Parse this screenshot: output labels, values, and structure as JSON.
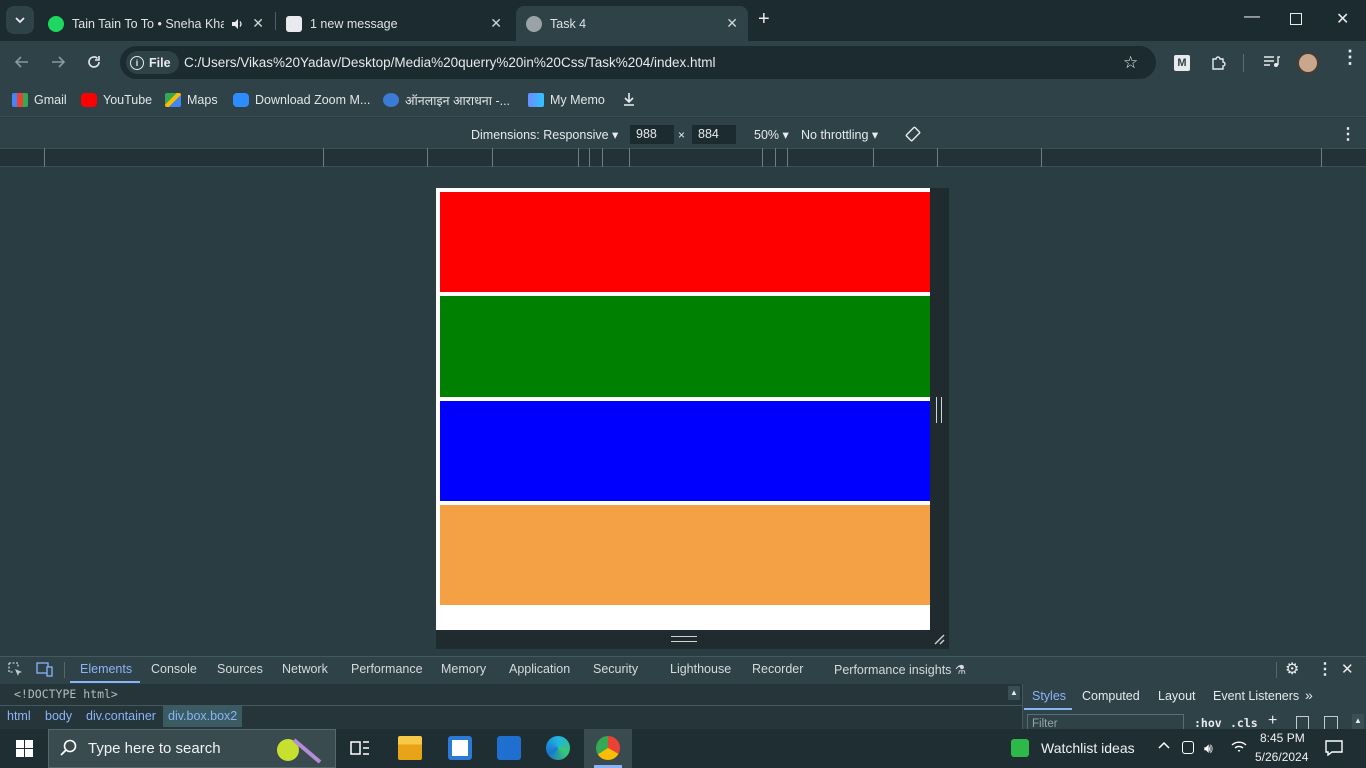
{
  "tabs": [
    {
      "title": "Tain Tain To To • Sneha Khan",
      "favicon": "spotify-icon"
    },
    {
      "title": "1 new message",
      "favicon": "wordpress-icon"
    },
    {
      "title": "Task 4",
      "favicon": "globe-icon",
      "active": true
    }
  ],
  "address_bar": {
    "scheme_label": "File",
    "url": "C:/Users/Vikas%20Yadav/Desktop/Media%20querry%20in%20Css/Task%204/index.html"
  },
  "bookmarks": [
    {
      "label": "Gmail",
      "icon": "gmail-icon"
    },
    {
      "label": "YouTube",
      "icon": "youtube-icon"
    },
    {
      "label": "Maps",
      "icon": "maps-icon"
    },
    {
      "label": "Download Zoom M...",
      "icon": "zoom-icon"
    },
    {
      "label": "ऑनलाइन आराधना -...",
      "icon": "globe-icon"
    },
    {
      "label": "My Memo",
      "icon": "memo-icon"
    }
  ],
  "device_toolbar": {
    "dimensions_label": "Dimensions: Responsive",
    "width_value": "988",
    "times": "×",
    "height_value": "884",
    "zoom": "50%",
    "throttle": "No throttling"
  },
  "page_boxes": [
    {
      "name": "box1",
      "color": "#ff0000"
    },
    {
      "name": "box2",
      "color": "#008000"
    },
    {
      "name": "box3",
      "color": "#0000ff"
    },
    {
      "name": "box4",
      "color": "#f4a145"
    }
  ],
  "devtools": {
    "tabs": [
      "Elements",
      "Console",
      "Sources",
      "Network",
      "Performance",
      "Memory",
      "Application",
      "Security",
      "Lighthouse",
      "Recorder",
      "Performance insights"
    ],
    "active_tab": "Elements",
    "doctype": "<!DOCTYPE html>",
    "breadcrumbs": [
      "html",
      "body",
      "div.container",
      "div.box.box2"
    ],
    "side_tabs": [
      "Styles",
      "Computed",
      "Layout",
      "Event Listeners"
    ],
    "filter_placeholder": "Filter",
    "hov": ":hov",
    "cls": ".cls"
  },
  "taskbar": {
    "search_placeholder": "Type here to search",
    "watchlist": "Watchlist ideas",
    "time": "8:45 PM",
    "date": "5/26/2024"
  }
}
